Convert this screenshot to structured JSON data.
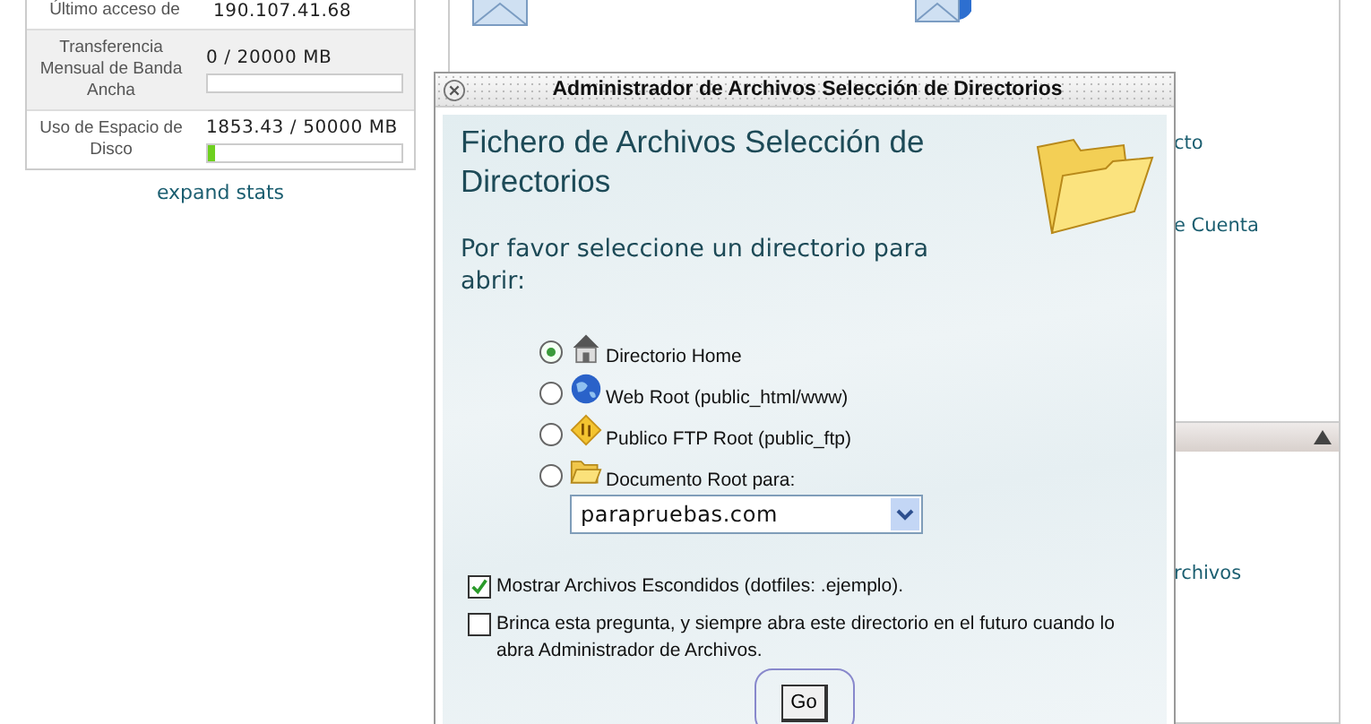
{
  "stats": [
    {
      "label": "Último acceso de",
      "value": "190.107.41.68",
      "kind": "text"
    },
    {
      "label": "Transferencia Mensual de Banda Ancha",
      "value": "0 / 20000 MB",
      "kind": "bar"
    },
    {
      "label": "Uso de Espacio de Disco",
      "value": "1853.43 / 50000 MB",
      "kind": "bar",
      "level": 0.037
    }
  ],
  "expand_link": "expand stats",
  "panel_links": [
    "cto",
    "e Cuenta"
  ],
  "lower_panel_links": [
    "rchivos"
  ],
  "dialog": {
    "title": "Administrador de Archivos Selección de Directorios",
    "heading": "Fichero de Archivos Selección de Directorios",
    "prompt": "Por favor seleccione un directorio para abrir:",
    "options": [
      {
        "kind": "home",
        "label": "Directorio Home",
        "selected": true
      },
      {
        "kind": "globe",
        "label": "Web Root (public_html/www)",
        "selected": false
      },
      {
        "kind": "ftp",
        "label": "Publico FTP Root (public_ftp)",
        "selected": false
      },
      {
        "kind": "folder",
        "label": "Documento Root para:",
        "selected": false
      }
    ],
    "domain_select": {
      "value": "parapruebas.com"
    },
    "checkboxes": [
      {
        "label": "Mostrar Archivos Escondidos (dotfiles: .ejemplo).",
        "checked": true
      },
      {
        "label": "Brinca esta pregunta, y siempre abra este directorio en el futuro cuando lo abra Administrador de Archivos.",
        "checked": false
      }
    ],
    "button": "Go"
  }
}
